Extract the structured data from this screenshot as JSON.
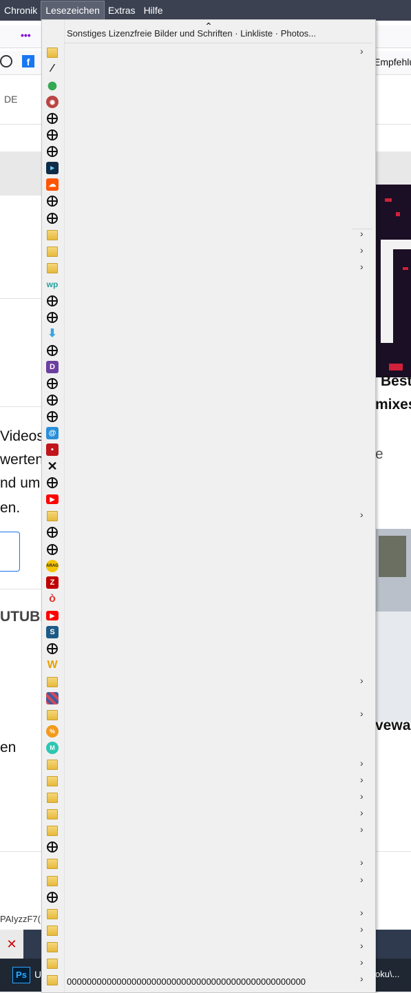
{
  "menubar": {
    "items": [
      "Chronik",
      "Lesezeichen",
      "Extras",
      "Hilfe"
    ]
  },
  "background": {
    "fragments": {
      "de": "DE",
      "empfehlu": "Empfehlu",
      "videos": "Videos",
      "werten": "werten",
      "ndum": "nd um",
      "en1": "en.",
      "utube": "UTUBE",
      "en2": "en",
      "best": "Best",
      "mixes": "mixes",
      "e": "e",
      "veway": "veway",
      "paiyzz": "PAIyzzF7("
    }
  },
  "menu": {
    "scroll_up": "⌃",
    "header": "Sonstiges Lizenzfreie Bilder und Schriften · Linkliste · Photos...",
    "footer": "000000000000000000000000000000000000000000000000",
    "items": [
      {
        "icon": "folder-icon",
        "arrow": true
      },
      {
        "icon": "logo-link-icon",
        "arrow": false
      },
      {
        "icon": "maps-pin-icon",
        "arrow": false
      },
      {
        "icon": "mascot-icon",
        "arrow": false
      },
      {
        "icon": "globe-icon",
        "arrow": false
      },
      {
        "icon": "globe-icon",
        "arrow": false
      },
      {
        "icon": "globe-icon",
        "arrow": false
      },
      {
        "icon": "deepl-icon",
        "arrow": false
      },
      {
        "icon": "soundcloud-icon",
        "arrow": false
      },
      {
        "icon": "globe-icon",
        "arrow": false
      },
      {
        "icon": "globe-icon",
        "arrow": false
      },
      {
        "icon": "folder-icon",
        "arrow": true
      },
      {
        "icon": "folder-icon",
        "arrow": true
      },
      {
        "icon": "folder-icon",
        "arrow": true
      },
      {
        "icon": "wp-icon",
        "arrow": false
      },
      {
        "icon": "globe-icon",
        "arrow": false
      },
      {
        "icon": "globe-icon",
        "arrow": false
      },
      {
        "icon": "download-arrows-icon",
        "arrow": false
      },
      {
        "icon": "globe-icon",
        "arrow": false
      },
      {
        "icon": "d-logo-icon",
        "arrow": false
      },
      {
        "icon": "globe-icon",
        "arrow": false
      },
      {
        "icon": "globe-icon",
        "arrow": false
      },
      {
        "icon": "globe-icon",
        "arrow": false
      },
      {
        "icon": "swirl-icon",
        "arrow": false
      },
      {
        "icon": "red-box-icon",
        "arrow": false
      },
      {
        "icon": "x-icon",
        "arrow": false
      },
      {
        "icon": "globe-icon",
        "arrow": false
      },
      {
        "icon": "youtube-icon",
        "arrow": false
      },
      {
        "icon": "folder-icon",
        "arrow": true
      },
      {
        "icon": "globe-icon",
        "arrow": false
      },
      {
        "icon": "globe-icon",
        "arrow": false
      },
      {
        "icon": "arag-icon",
        "arrow": false
      },
      {
        "icon": "filezilla-icon",
        "arrow": false
      },
      {
        "icon": "o-logo-icon",
        "arrow": false
      },
      {
        "icon": "youtube-icon",
        "arrow": false
      },
      {
        "icon": "s-logo-icon",
        "arrow": false
      },
      {
        "icon": "globe-icon",
        "arrow": false
      },
      {
        "icon": "w-logo-icon",
        "arrow": false
      },
      {
        "icon": "folder-icon",
        "arrow": true
      },
      {
        "icon": "stripes-icon",
        "arrow": false
      },
      {
        "icon": "folder-icon",
        "arrow": true
      },
      {
        "icon": "percent-icon",
        "arrow": false
      },
      {
        "icon": "m-logo-icon",
        "arrow": false
      },
      {
        "icon": "folder-icon",
        "arrow": true
      },
      {
        "icon": "folder-icon",
        "arrow": true
      },
      {
        "icon": "folder-icon",
        "arrow": true
      },
      {
        "icon": "folder-icon",
        "arrow": true
      },
      {
        "icon": "folder-icon",
        "arrow": true
      },
      {
        "icon": "globe-icon",
        "arrow": false
      },
      {
        "icon": "folder-icon",
        "arrow": true
      },
      {
        "icon": "folder-icon",
        "arrow": true
      },
      {
        "icon": "globe-icon",
        "arrow": false
      },
      {
        "icon": "folder-icon",
        "arrow": true
      },
      {
        "icon": "folder-icon",
        "arrow": true
      },
      {
        "icon": "folder-icon",
        "arrow": true
      },
      {
        "icon": "folder-icon",
        "arrow": true
      },
      {
        "icon": "folder-icon",
        "arrow": true
      }
    ]
  },
  "taskbar": {
    "app_letter": "Ps",
    "label": "U",
    "right_label": "oku\\..."
  }
}
